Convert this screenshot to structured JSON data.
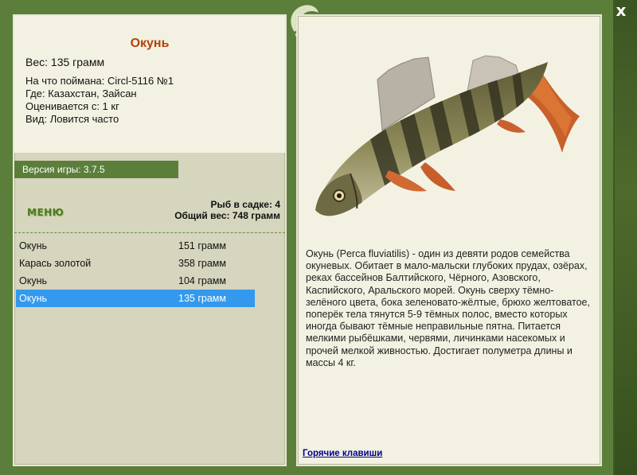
{
  "window": {
    "close_glyph": "x"
  },
  "info": {
    "title": "Окунь",
    "weight": "Вес: 135 грамм",
    "caught_with": "На что поймана: Circl-5116 №1",
    "location": "Где: Казахстан, Зайсан",
    "valued_from": "Оценивается с: 1 кг",
    "frequency": "Вид: Ловится часто"
  },
  "version": "Версия игры: 3.7.5",
  "menu_label": "МЕНЮ",
  "stats": {
    "count": "Рыб в садке: 4",
    "total": "Общий вес: 748 грамм"
  },
  "catch": [
    {
      "name": "Окунь",
      "weight": "151 грамм",
      "selected": false
    },
    {
      "name": "Карась золотой",
      "weight": "358 грамм",
      "selected": false
    },
    {
      "name": "Окунь",
      "weight": "104 грамм",
      "selected": false
    },
    {
      "name": "Окунь",
      "weight": "135 грамм",
      "selected": true
    }
  ],
  "description": "Окунь (Perca fluviatilis) - один из девяти родов семейства окуневых. Обитает в мало-мальски глубоких прудах, озёрах, реках бассейнов Балтийского, Чёрного, Азовского, Каспийского, Аральского морей. Окунь сверху тёмно-зелёного цвета, бока зеленовато-жёлтые, брюхо желтоватое, поперёк тела тянутся 5-9 тёмных полос, вместо которых иногда бывают тёмные неправильные пятна. Питается мелкими рыбёшками, червями, личинками насекомых и прочей мелкой живностью. Достигает полуметра длины и массы 4 кг.",
  "hotkeys": "Горячие клавиши",
  "colors": {
    "frame": "#5b7f3a",
    "panel": "#f3f2e2",
    "title": "#b5420a",
    "selection": "#3399ee",
    "link": "#00008b"
  }
}
